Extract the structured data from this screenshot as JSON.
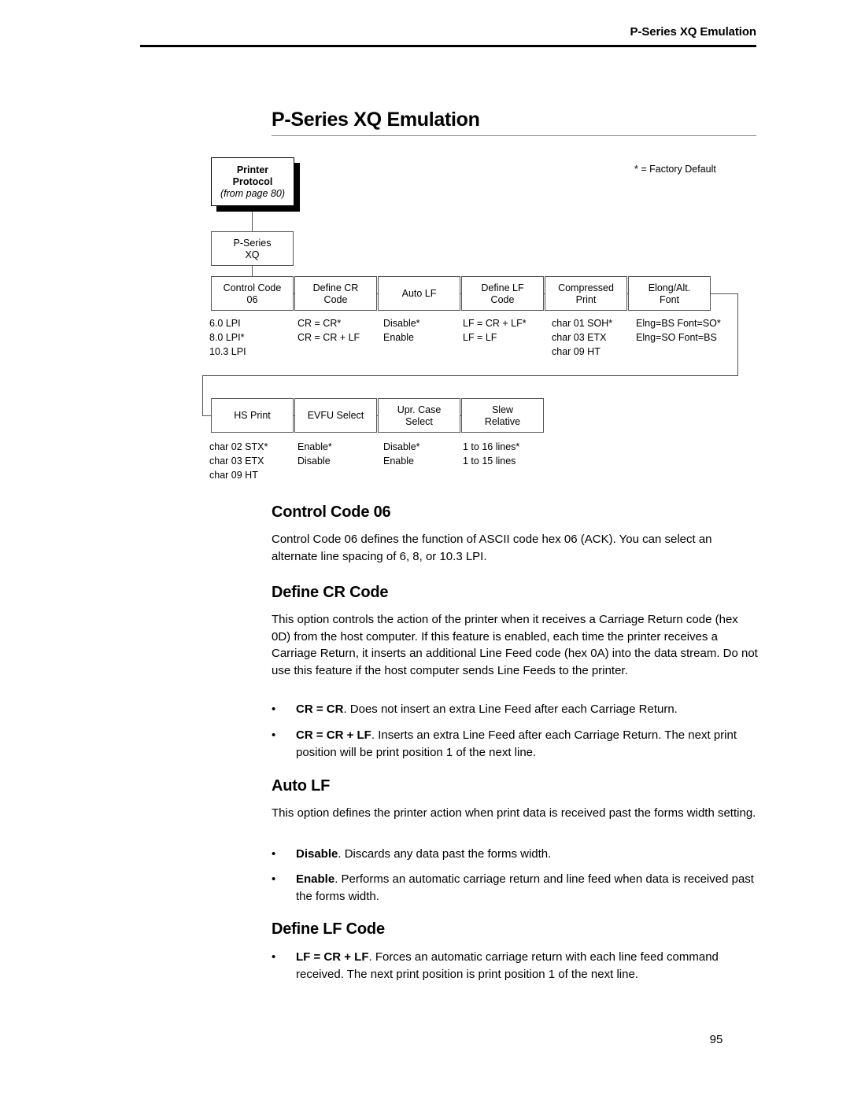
{
  "header": {
    "running_title": "P-Series XQ Emulation"
  },
  "chapter": {
    "title": "P-Series XQ Emulation"
  },
  "diagram": {
    "factory_default_note": "* = Factory Default",
    "root": {
      "line1": "Printer",
      "line2": "Protocol",
      "line3": "(from page 80)"
    },
    "protocol": {
      "line1": "P-Series",
      "line2": "XQ"
    },
    "row1": [
      {
        "line1": "Control Code",
        "line2": "06",
        "options": [
          "6.0 LPI",
          "8.0 LPI*",
          "10.3 LPI"
        ]
      },
      {
        "line1": "Define CR",
        "line2": "Code",
        "options": [
          "CR = CR*",
          "CR = CR + LF"
        ]
      },
      {
        "line1": "Auto LF",
        "line2": "",
        "options": [
          "Disable*",
          "Enable"
        ]
      },
      {
        "line1": "Define LF",
        "line2": "Code",
        "options": [
          "LF = CR + LF*",
          "LF = LF"
        ]
      },
      {
        "line1": "Compressed",
        "line2": "Print",
        "options": [
          "char 01 SOH*",
          "char 03 ETX",
          "char 09 HT"
        ]
      },
      {
        "line1": "Elong/Alt.",
        "line2": "Font",
        "options": [
          "Elng=BS Font=SO*",
          "Elng=SO Font=BS"
        ]
      }
    ],
    "row2": [
      {
        "line1": "HS Print",
        "line2": "",
        "options": [
          "char 02 STX*",
          "char 03 ETX",
          "char 09 HT"
        ]
      },
      {
        "line1": "EVFU Select",
        "line2": "",
        "options": [
          "Enable*",
          "Disable"
        ]
      },
      {
        "line1": "Upr. Case",
        "line2": "Select",
        "options": [
          "Disable*",
          "Enable"
        ]
      },
      {
        "line1": "Slew",
        "line2": "Relative",
        "options": [
          "1 to 16 lines*",
          "1 to 15 lines"
        ]
      }
    ]
  },
  "sections": {
    "control_code_06": {
      "heading": "Control Code 06",
      "paragraph": "Control Code 06 defines the function of ASCII code hex 06 (ACK). You can select an alternate line spacing of 6, 8, or 10.3 LPI."
    },
    "define_cr_code": {
      "heading": "Define CR Code",
      "paragraph": "This option controls the action of the printer when it receives a Carriage Return code (hex 0D) from the host computer. If this feature is enabled, each time the printer receives a Carriage Return, it inserts an additional Line Feed code (hex 0A) into the data stream. Do not use this feature if the host computer sends Line Feeds to the printer.",
      "bullets": [
        {
          "marker": "•",
          "bold": "CR = CR",
          "rest": ". Does not insert an extra Line Feed after each Carriage Return."
        },
        {
          "marker": "•",
          "bold": "CR = CR + LF",
          "rest": ". Inserts an extra Line Feed after each Carriage Return. The next print position will be print position 1 of the next line."
        }
      ]
    },
    "auto_lf": {
      "heading": "Auto LF",
      "paragraph": "This option defines the printer action when print data is received past the forms width setting.",
      "bullets": [
        {
          "marker": "•",
          "bold": "Disable",
          "rest": ". Discards any data past the forms width."
        },
        {
          "marker": "•",
          "bold": "Enable",
          "rest": ". Performs an automatic carriage return and line feed when data is received past the forms width."
        }
      ]
    },
    "define_lf_code": {
      "heading": "Define LF Code",
      "bullets": [
        {
          "marker": "•",
          "bold": "LF = CR + LF",
          "rest": ". Forces an automatic carriage return with each line feed command received. The next print position is print position 1 of the next line."
        }
      ]
    }
  },
  "footer": {
    "page_number": "95"
  }
}
